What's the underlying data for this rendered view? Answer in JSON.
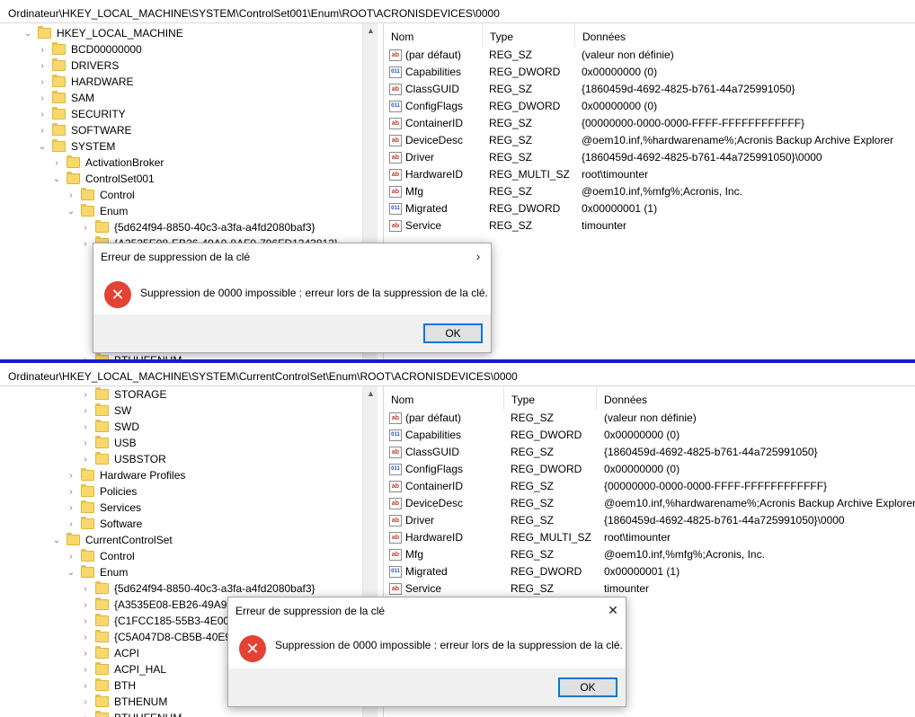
{
  "top": {
    "address": "Ordinateur\\HKEY_LOCAL_MACHINE\\SYSTEM\\ControlSet001\\Enum\\ROOT\\ACRONISDEVICES\\0000",
    "tree": [
      {
        "label": "HKEY_LOCAL_MACHINE",
        "expander": "down"
      },
      {
        "label": "BCD00000000",
        "expander": "right"
      },
      {
        "label": "DRIVERS",
        "expander": "right"
      },
      {
        "label": "HARDWARE",
        "expander": "right"
      },
      {
        "label": "SAM",
        "expander": "right"
      },
      {
        "label": "SECURITY",
        "expander": "right"
      },
      {
        "label": "SOFTWARE",
        "expander": "right"
      },
      {
        "label": "SYSTEM",
        "expander": "down"
      },
      {
        "label": "ActivationBroker",
        "expander": "right"
      },
      {
        "label": "ControlSet001",
        "expander": "down"
      },
      {
        "label": "Control",
        "expander": "right"
      },
      {
        "label": "Enum",
        "expander": "down"
      },
      {
        "label": "{5d624f94-8850-40c3-a3fa-a4fd2080baf3}",
        "expander": "right"
      },
      {
        "label": "{A3535E08-EB26-49A9-8AF9-796FD1343812}",
        "expander": "right"
      },
      {
        "label": "BTHHFENUM",
        "expander": "right"
      }
    ],
    "columns": {
      "name": "Nom",
      "type": "Type",
      "data": "Données"
    },
    "values": [
      {
        "name": "(par défaut)",
        "type": "REG_SZ",
        "data": "(valeur non définie)",
        "icon": "string-value-icon"
      },
      {
        "name": "Capabilities",
        "type": "REG_DWORD",
        "data": "0x00000000 (0)",
        "icon": "dword-value-icon"
      },
      {
        "name": "ClassGUID",
        "type": "REG_SZ",
        "data": "{1860459d-4692-4825-b761-44a725991050}",
        "icon": "string-value-icon"
      },
      {
        "name": "ConfigFlags",
        "type": "REG_DWORD",
        "data": "0x00000000 (0)",
        "icon": "dword-value-icon"
      },
      {
        "name": "ContainerID",
        "type": "REG_SZ",
        "data": "{00000000-0000-0000-FFFF-FFFFFFFFFFFF}",
        "icon": "string-value-icon"
      },
      {
        "name": "DeviceDesc",
        "type": "REG_SZ",
        "data": "@oem10.inf,%hardwarename%;Acronis Backup Archive Explorer",
        "icon": "string-value-icon"
      },
      {
        "name": "Driver",
        "type": "REG_SZ",
        "data": "{1860459d-4692-4825-b761-44a725991050}\\0000",
        "icon": "string-value-icon"
      },
      {
        "name": "HardwareID",
        "type": "REG_MULTI_SZ",
        "data": "root\\timounter",
        "icon": "string-value-icon"
      },
      {
        "name": "Mfg",
        "type": "REG_SZ",
        "data": "@oem10.inf,%mfg%;Acronis, Inc.",
        "icon": "string-value-icon"
      },
      {
        "name": "Migrated",
        "type": "REG_DWORD",
        "data": "0x00000001 (1)",
        "icon": "dword-value-icon"
      },
      {
        "name": "Service",
        "type": "REG_SZ",
        "data": "timounter",
        "icon": "string-value-icon"
      }
    ],
    "dialog": {
      "title": "Erreur de suppression de la clé",
      "close": "›",
      "message": "Suppression de 0000 impossible : erreur lors de la suppression de la clé.",
      "ok": "OK",
      "icon": "error-icon"
    }
  },
  "bottom": {
    "address": "Ordinateur\\HKEY_LOCAL_MACHINE\\SYSTEM\\CurrentControlSet\\Enum\\ROOT\\ACRONISDEVICES\\0000",
    "tree": [
      {
        "label": "STORAGE",
        "expander": "right"
      },
      {
        "label": "SW",
        "expander": "right"
      },
      {
        "label": "SWD",
        "expander": "right"
      },
      {
        "label": "USB",
        "expander": "right"
      },
      {
        "label": "USBSTOR",
        "expander": "right"
      },
      {
        "label": "Hardware Profiles",
        "expander": "right"
      },
      {
        "label": "Policies",
        "expander": "right"
      },
      {
        "label": "Services",
        "expander": "right"
      },
      {
        "label": "Software",
        "expander": "right"
      },
      {
        "label": "CurrentControlSet",
        "expander": "down"
      },
      {
        "label": "Control",
        "expander": "right"
      },
      {
        "label": "Enum",
        "expander": "down"
      },
      {
        "label": "{5d624f94-8850-40c3-a3fa-a4fd2080baf3}",
        "expander": "right"
      },
      {
        "label": "{A3535E08-EB26-49A9-8",
        "expander": "right"
      },
      {
        "label": "{C1FCC185-55B3-4E00-8",
        "expander": "right"
      },
      {
        "label": "{C5A047D8-CB5B-40E9-",
        "expander": "right"
      },
      {
        "label": "ACPI",
        "expander": "right"
      },
      {
        "label": "ACPI_HAL",
        "expander": "right"
      },
      {
        "label": "BTH",
        "expander": "right"
      },
      {
        "label": "BTHENUM",
        "expander": "right"
      },
      {
        "label": "BTHHFENUM",
        "expander": "right"
      }
    ],
    "columns": {
      "name": "Nom",
      "type": "Type",
      "data": "Données"
    },
    "values": [
      {
        "name": "(par défaut)",
        "type": "REG_SZ",
        "data": "(valeur non définie)",
        "icon": "string-value-icon"
      },
      {
        "name": "Capabilities",
        "type": "REG_DWORD",
        "data": "0x00000000 (0)",
        "icon": "dword-value-icon"
      },
      {
        "name": "ClassGUID",
        "type": "REG_SZ",
        "data": "{1860459d-4692-4825-b761-44a725991050}",
        "icon": "string-value-icon"
      },
      {
        "name": "ConfigFlags",
        "type": "REG_DWORD",
        "data": "0x00000000 (0)",
        "icon": "dword-value-icon"
      },
      {
        "name": "ContainerID",
        "type": "REG_SZ",
        "data": "{00000000-0000-0000-FFFF-FFFFFFFFFFFF}",
        "icon": "string-value-icon"
      },
      {
        "name": "DeviceDesc",
        "type": "REG_SZ",
        "data": "@oem10.inf,%hardwarename%;Acronis Backup Archive Explorer",
        "icon": "string-value-icon"
      },
      {
        "name": "Driver",
        "type": "REG_SZ",
        "data": "{1860459d-4692-4825-b761-44a725991050}\\0000",
        "icon": "string-value-icon"
      },
      {
        "name": "HardwareID",
        "type": "REG_MULTI_SZ",
        "data": "root\\timounter",
        "icon": "string-value-icon"
      },
      {
        "name": "Mfg",
        "type": "REG_SZ",
        "data": "@oem10.inf,%mfg%;Acronis, Inc.",
        "icon": "string-value-icon"
      },
      {
        "name": "Migrated",
        "type": "REG_DWORD",
        "data": "0x00000001 (1)",
        "icon": "dword-value-icon"
      },
      {
        "name": "Service",
        "type": "REG_SZ",
        "data": "timounter",
        "icon": "string-value-icon"
      }
    ],
    "dialog": {
      "title": "Erreur de suppression de la clé",
      "close": "✕",
      "message": "Suppression de 0000 impossible : erreur lors de la suppression de la clé.",
      "ok": "OK",
      "icon": "error-icon"
    }
  },
  "icons": {
    "string_glyph": "ab",
    "dword_glyph": "011",
    "error_glyph": "✕",
    "chevron_right": "›",
    "chevron_down": "⌄",
    "scroll_up": "▲",
    "scroll_down": "▼"
  }
}
